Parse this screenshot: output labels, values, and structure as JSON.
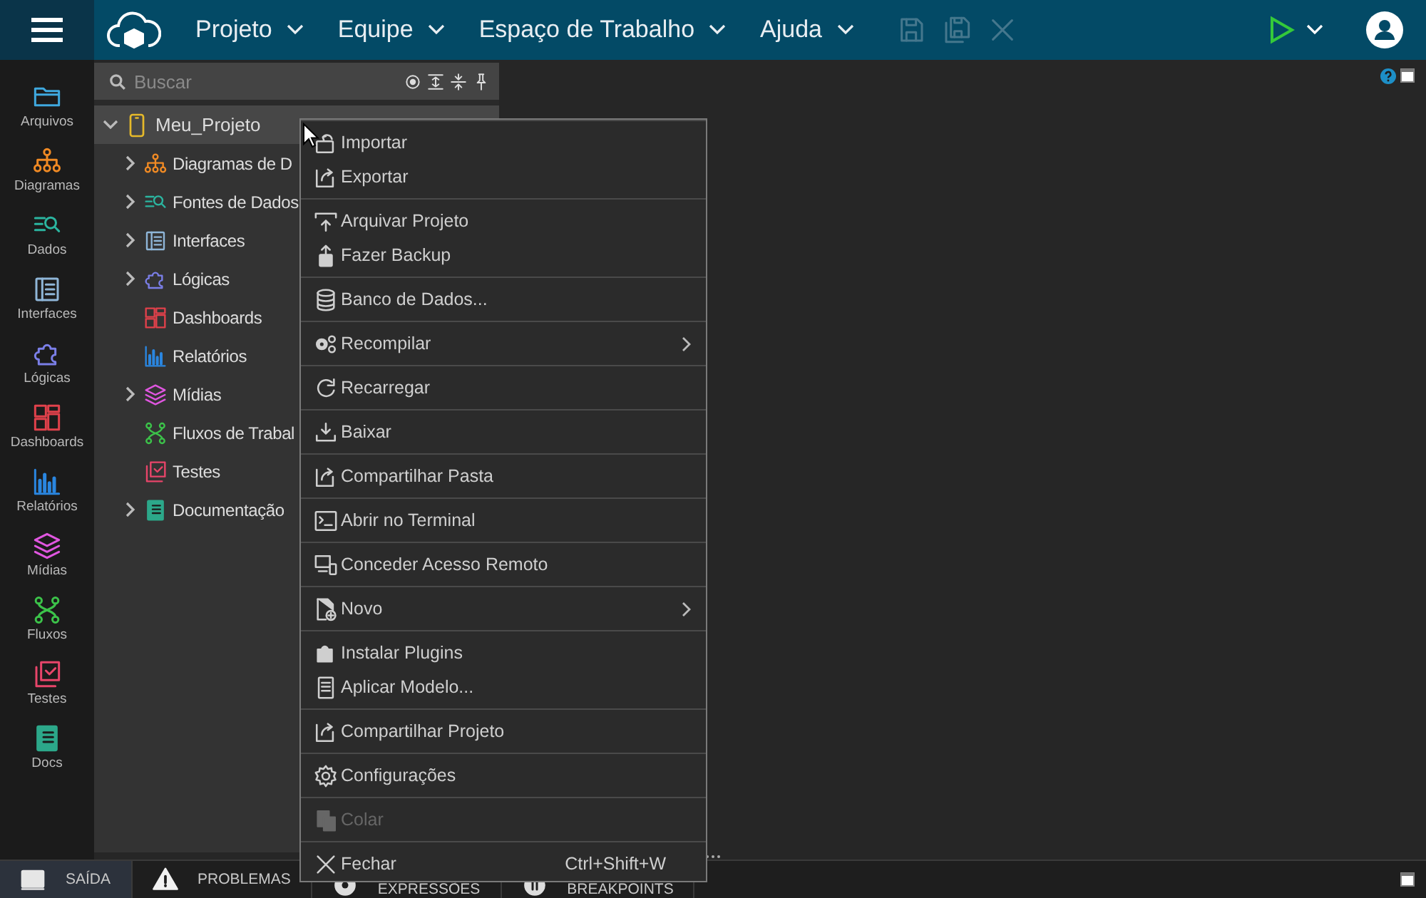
{
  "topbar": {
    "menus": [
      {
        "label": "Projeto"
      },
      {
        "label": "Equipe"
      },
      {
        "label": "Espaço de Trabalho"
      },
      {
        "label": "Ajuda"
      }
    ],
    "actions": [
      {
        "disabled": true
      },
      {
        "disabled": true
      },
      {
        "disabled": true
      }
    ]
  },
  "rail": {
    "items": [
      {
        "label": "Arquivos",
        "color": "#3fa9df"
      },
      {
        "label": "Diagramas",
        "color": "#f08a24"
      },
      {
        "label": "Dados",
        "color": "#2bb5a0"
      },
      {
        "label": "Interfaces",
        "color": "#8fb6d8"
      },
      {
        "label": "Lógicas",
        "color": "#7b7fe8"
      },
      {
        "label": "Dashboards",
        "color": "#e0414b"
      },
      {
        "label": "Relatórios",
        "color": "#2a86e0"
      },
      {
        "label": "Mídias",
        "color": "#e056e0"
      },
      {
        "label": "Fluxos",
        "color": "#3cc34a"
      },
      {
        "label": "Testes",
        "color": "#e8456a"
      },
      {
        "label": "Docs",
        "color": "#2ca88a"
      }
    ]
  },
  "search": {
    "placeholder": "Buscar"
  },
  "tree": {
    "label": "Meu_Projeto",
    "color": "#e5b92a",
    "expanded": true,
    "children": [
      {
        "label": "Diagramas de D",
        "kind": "group",
        "color": "#f08a24"
      },
      {
        "label": "Fontes de Dados",
        "kind": "group",
        "color": "#2bb5a0"
      },
      {
        "label": "Interfaces",
        "kind": "group",
        "color": "#8fb6d8"
      },
      {
        "label": "Lógicas",
        "kind": "group",
        "color": "#7b7fe8"
      },
      {
        "label": "Dashboards",
        "kind": "leaf",
        "color": "#e0414b"
      },
      {
        "label": "Relatórios",
        "kind": "leaf",
        "color": "#2a86e0"
      },
      {
        "label": "Mídias",
        "kind": "group",
        "color": "#e056e0"
      },
      {
        "label": "Fluxos de Trabal",
        "kind": "leaf",
        "color": "#3cc34a"
      },
      {
        "label": "Testes",
        "kind": "leaf",
        "color": "#e8456a"
      },
      {
        "label": "Documentação",
        "kind": "group",
        "color": "#2ca88a"
      }
    ]
  },
  "context_menu": {
    "groups": [
      {
        "items": [
          {
            "label": "Importar",
            "disabled": false,
            "submenu": false
          },
          {
            "label": "Exportar",
            "disabled": false,
            "submenu": false
          }
        ]
      },
      {
        "items": [
          {
            "label": "Arquivar Projeto",
            "disabled": false,
            "submenu": false
          },
          {
            "label": "Fazer Backup",
            "disabled": false,
            "submenu": false
          }
        ]
      },
      {
        "items": [
          {
            "label": "Banco de Dados...",
            "disabled": false,
            "submenu": false
          }
        ]
      },
      {
        "items": [
          {
            "label": "Recompilar",
            "disabled": false,
            "submenu": true
          }
        ]
      },
      {
        "items": [
          {
            "label": "Recarregar",
            "disabled": false,
            "submenu": false
          }
        ]
      },
      {
        "items": [
          {
            "label": "Baixar",
            "disabled": false,
            "submenu": false
          }
        ]
      },
      {
        "items": [
          {
            "label": "Compartilhar Pasta",
            "disabled": false,
            "submenu": false
          }
        ]
      },
      {
        "items": [
          {
            "label": "Abrir no Terminal",
            "disabled": false,
            "submenu": false
          }
        ]
      },
      {
        "items": [
          {
            "label": "Conceder Acesso Remoto",
            "disabled": false,
            "submenu": false
          }
        ]
      },
      {
        "items": [
          {
            "label": "Novo",
            "disabled": false,
            "submenu": true
          }
        ]
      },
      {
        "items": [
          {
            "label": "Instalar Plugins",
            "disabled": false,
            "submenu": false
          },
          {
            "label": "Aplicar Modelo...",
            "disabled": false,
            "submenu": false
          }
        ]
      },
      {
        "items": [
          {
            "label": "Compartilhar Projeto",
            "disabled": false,
            "submenu": false
          }
        ]
      },
      {
        "items": [
          {
            "label": "Configurações",
            "disabled": false,
            "submenu": false
          }
        ]
      },
      {
        "items": [
          {
            "label": "Colar",
            "disabled": true,
            "submenu": false
          }
        ]
      },
      {
        "items": [
          {
            "label": "Fechar",
            "disabled": false,
            "submenu": false,
            "shortcut": "Ctrl+Shift+W"
          }
        ]
      }
    ]
  },
  "bottom_tabs": [
    {
      "label": "SAÍDA",
      "selected": true
    },
    {
      "label": "PROBLEMAS",
      "selected": false
    },
    {
      "label": "EXPRESSÕES",
      "selected": false
    },
    {
      "label": "BREAKPOINTS",
      "selected": false
    }
  ]
}
